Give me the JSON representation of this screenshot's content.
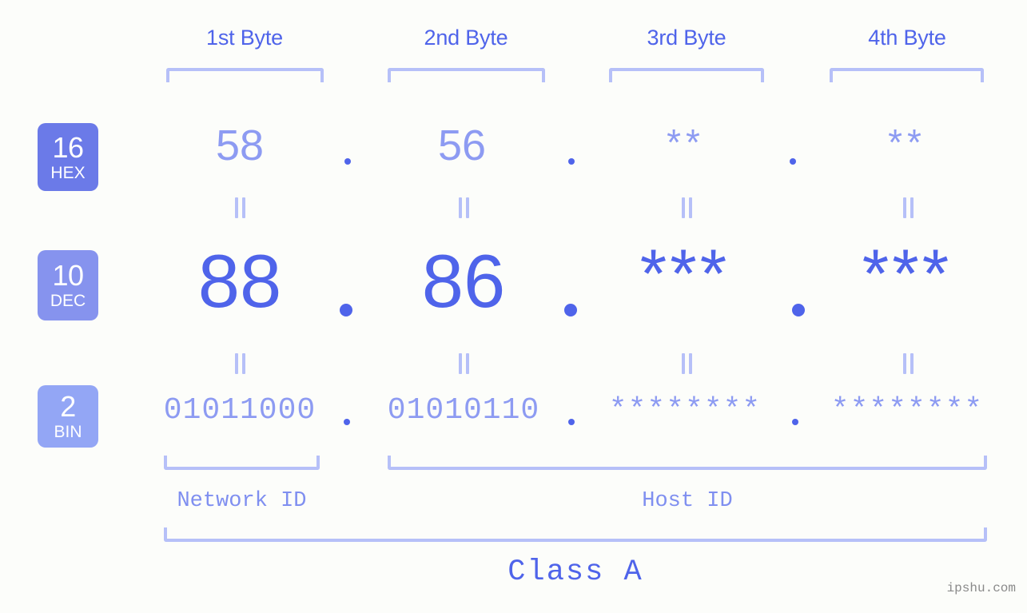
{
  "meta": {
    "background_color": "#fcfdfa",
    "accent_color": "#4f64ea",
    "accent_light_color": "#8d9bf2",
    "bracket_color": "#b6c0f8"
  },
  "headers": [
    {
      "label": "1st Byte"
    },
    {
      "label": "2nd Byte"
    },
    {
      "label": "3rd Byte"
    },
    {
      "label": "4th Byte"
    }
  ],
  "bases": [
    {
      "number": "16",
      "name": "HEX",
      "color": "#6b7ae8"
    },
    {
      "number": "10",
      "name": "DEC",
      "color": "#8693ee"
    },
    {
      "number": "2",
      "name": "BIN",
      "color": "#93a6f5"
    }
  ],
  "rows": {
    "hex": {
      "base_number": "16",
      "base_name": "HEX",
      "values": [
        "58",
        "56",
        "**",
        "**"
      ],
      "separator": "."
    },
    "dec": {
      "base_number": "10",
      "base_name": "DEC",
      "values": [
        "88",
        "86",
        "***",
        "***"
      ],
      "separator": "."
    },
    "bin": {
      "base_number": "2",
      "base_name": "BIN",
      "values": [
        "01011000",
        "01010110",
        "********",
        "********"
      ],
      "separator": "."
    }
  },
  "equals_marks": {
    "glyph": "||",
    "count_per_gap": 4
  },
  "sections": [
    {
      "label": "Network ID"
    },
    {
      "label": "Host ID"
    }
  ],
  "class": {
    "label": "Class A"
  },
  "watermark": {
    "text": "ipshu.com"
  }
}
